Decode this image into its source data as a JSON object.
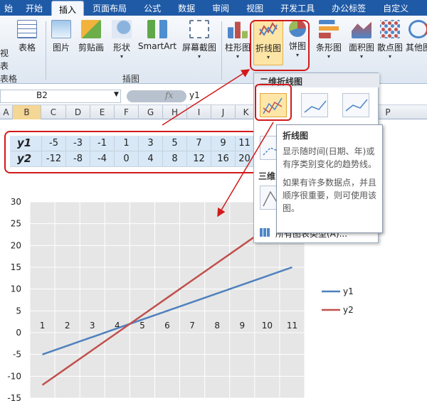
{
  "tabs": [
    "始",
    "开始",
    "插入",
    "页面布局",
    "公式",
    "数据",
    "审阅",
    "视图",
    "开发工具",
    "办公标签",
    "自定义"
  ],
  "ribbon": {
    "buttons": [
      {
        "label": "表格",
        "icon": "table-icon"
      },
      {
        "label": "图片",
        "icon": "picture-icon"
      },
      {
        "label": "剪贴画",
        "icon": "clipart-icon"
      },
      {
        "label": "形状",
        "icon": "shapes-icon"
      },
      {
        "label": "SmartArt",
        "icon": "smartart-icon"
      },
      {
        "label": "屏幕截图",
        "icon": "screenshot-icon"
      },
      {
        "label": "柱形图",
        "icon": "column-chart-icon"
      },
      {
        "label": "折线图",
        "icon": "line-chart-icon"
      },
      {
        "label": "饼图",
        "icon": "pie-chart-icon"
      },
      {
        "label": "条形图",
        "icon": "bar-chart-icon"
      },
      {
        "label": "面积图",
        "icon": "area-chart-icon"
      },
      {
        "label": "散点图",
        "icon": "scatter-chart-icon"
      },
      {
        "label": "其他图",
        "icon": "other-chart-icon"
      }
    ],
    "groups": {
      "table": "表格",
      "illustrations": "插图"
    },
    "left_edge_labels": [
      "视",
      "表"
    ]
  },
  "formula_bar": {
    "name_box": "B2",
    "fx": "fx",
    "value": "y1"
  },
  "columns": [
    "A",
    "B",
    "C",
    "D",
    "E",
    "F",
    "G",
    "H",
    "I",
    "J",
    "K",
    "P"
  ],
  "table": {
    "rows": [
      {
        "header": "y1",
        "values": [
          "-5",
          "-3",
          "-1",
          "1",
          "3",
          "5",
          "7",
          "9",
          "11"
        ]
      },
      {
        "header": "y2",
        "values": [
          "-12",
          "-8",
          "-4",
          "0",
          "4",
          "8",
          "12",
          "16",
          "20"
        ]
      }
    ]
  },
  "dropdown": {
    "title": "二维折线图",
    "section2": "三维",
    "all_types": "所有图表类型(A)..."
  },
  "tooltip": {
    "title": "折线图",
    "p1": "显示随时间(日期、年)或有序类别变化的趋势线。",
    "p2": "如果有许多数据点，并且顺序很重要，则可使用该图。"
  },
  "chart_data": {
    "type": "line",
    "x": [
      1,
      2,
      3,
      4,
      5,
      6,
      7,
      8,
      9,
      10,
      11
    ],
    "series": [
      {
        "name": "y1",
        "values": [
          -5,
          -3,
          -1,
          1,
          3,
          5,
          7,
          9,
          11,
          13,
          15
        ],
        "color": "#4f81bd"
      },
      {
        "name": "y2",
        "values": [
          -12,
          -8,
          -4,
          0,
          4,
          8,
          12,
          16,
          20,
          24,
          28
        ],
        "color": "#c0504d"
      }
    ],
    "ylim": [
      -15,
      30
    ],
    "yticks": [
      "30",
      "25",
      "20",
      "15",
      "10",
      "5",
      "0",
      "-5",
      "-10",
      "-15"
    ],
    "xticks": [
      "1",
      "2",
      "3",
      "4",
      "5",
      "6",
      "7",
      "8",
      "9",
      "10",
      "11"
    ],
    "grid": true,
    "legend": "right"
  },
  "colors": {
    "accent_red": "#d11a1a",
    "tab_blue": "#1f5aa6"
  }
}
